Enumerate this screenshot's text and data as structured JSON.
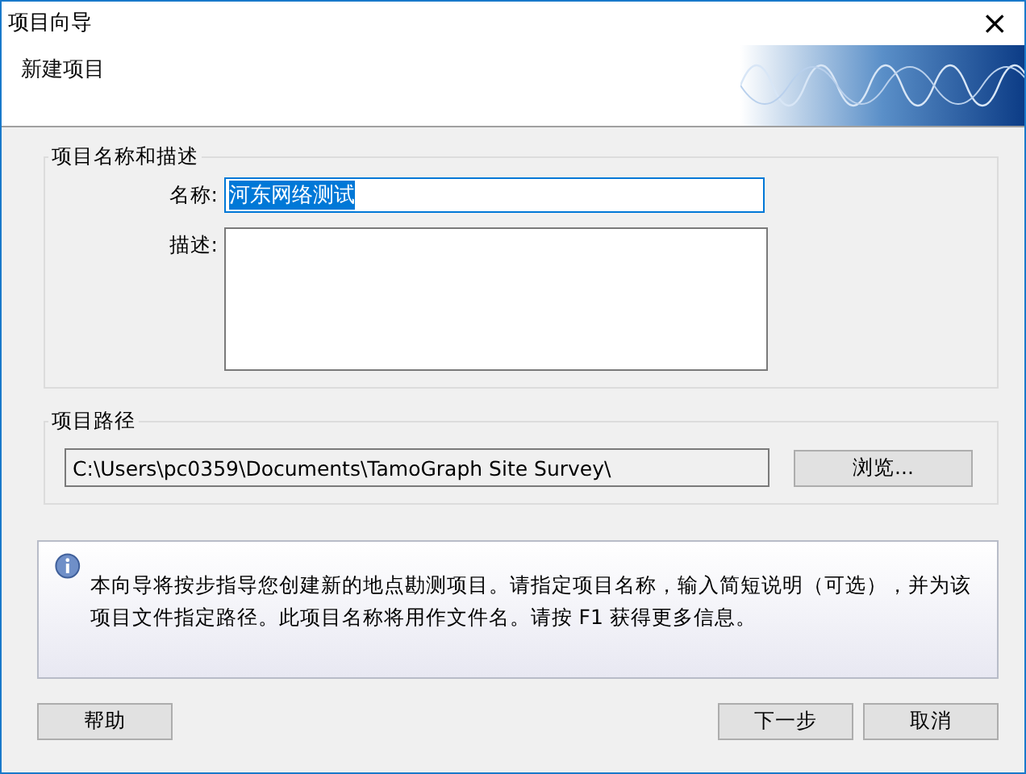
{
  "window": {
    "title": "项目向导",
    "close": "×"
  },
  "header": {
    "title": "新建项目"
  },
  "name_group": {
    "title": "项目名称和描述",
    "name_label": "名称:",
    "name_value": "河东网络测试",
    "name_selected": true,
    "desc_label": "描述:"
  },
  "path_group": {
    "title": "项目路径",
    "path": "C:\\Users\\pc0359\\Documents\\TamoGraph Site Survey\\",
    "browse": "浏览..."
  },
  "info": "本向导将按步指导您创建新的地点勘测项目。请指定项目名称，输入简短说明（可选），并为该项目文件指定路径。此项目名称将用作文件名。请按 F1 获得更多信息。",
  "buttons": [
    {
      "label": "帮助",
      "kind": "left"
    },
    {
      "label": "下一步",
      "kind": "right"
    },
    {
      "label": "取消",
      "kind": "right"
    }
  ]
}
